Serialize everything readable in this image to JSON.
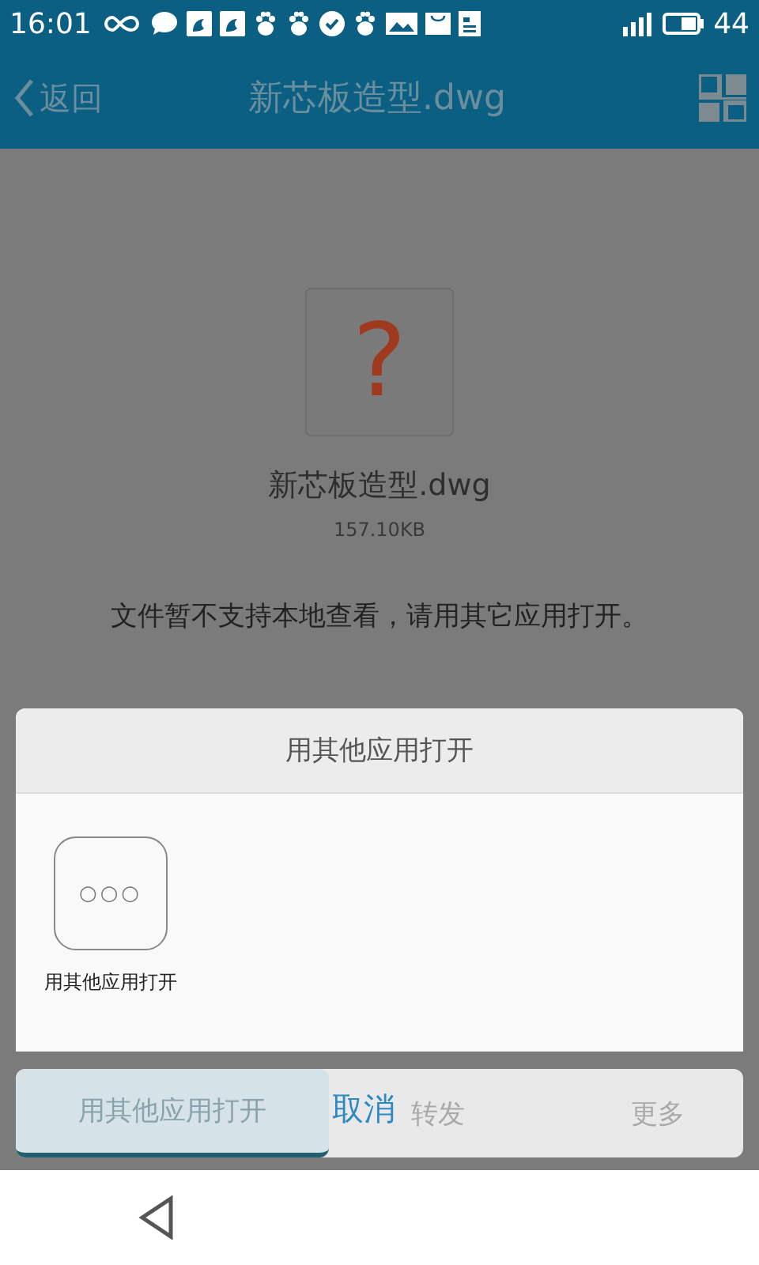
{
  "status_bar": {
    "time": "16:01",
    "battery": "44"
  },
  "header": {
    "back": "返回",
    "title": "新芯板造型.dwg"
  },
  "file": {
    "icon_glyph": "?",
    "name": "新芯板造型.dwg",
    "size": "157.10KB",
    "message": "文件暂不支持本地查看，请用其它应用打开。"
  },
  "dialog": {
    "title": "用其他应用打开",
    "apps": [
      {
        "label": "用其他应用打开",
        "glyph": "○○○"
      }
    ],
    "cancel": "取消"
  },
  "bottom_bar": {
    "buttons": [
      {
        "label": "用其他应用打开",
        "selected": true
      },
      {
        "label": "转发",
        "selected": false
      },
      {
        "label": "更多",
        "selected": false
      }
    ]
  }
}
